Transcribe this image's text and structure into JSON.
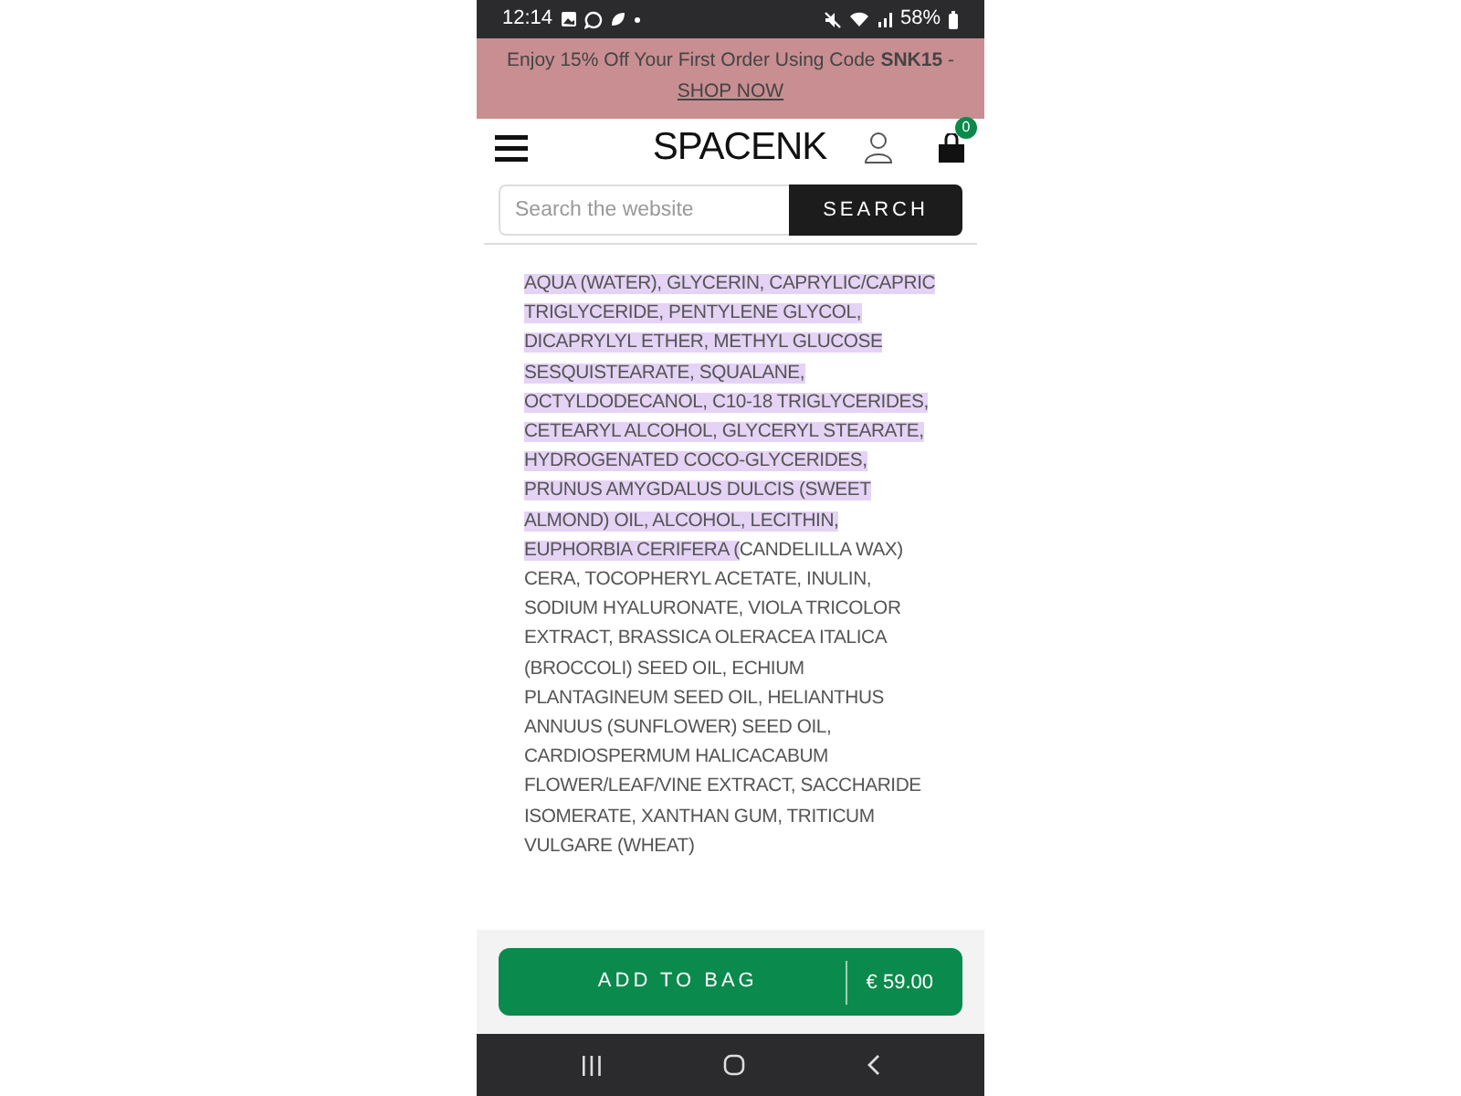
{
  "status_bar": {
    "time": "12:14",
    "battery": "58%"
  },
  "promo": {
    "text": "Enjoy 15% Off Your First Order Using Code **SNK15** -",
    "link": "SHOP NOW"
  },
  "header": {
    "logo": "SPACENK",
    "bag_count": "0"
  },
  "search": {
    "placeholder": "Search the website",
    "button": "SEARCH"
  },
  "ingredients": [
    {
      "text": "AQUA (WATER), GLYCERIN, CAPRYLIC/CAPRIC TRIGLYCERIDE, PENTYLENE GLYCOL, DICAPRYLYL ETHER, METHYL GLUCOSE SESQUISTEARATE, SQUALANE, OCTYLDODECANOL, C10-18 TRIGLYCERIDES, CETEARYL ALCOHOL, GLYCERYL STEARATE, HYDROGENATED COCO-GLYCERIDES, PRUNUS AMYGDALUS DULCIS (SWEET ALMOND) OIL, ALCOHOL, LECITHIN, EUPHORBIA CERIFERA (",
      "selected": true
    },
    {
      "text": "CANDELILLA WAX) CERA, TOCOPHERYL ACETATE, INULIN, SODIUM HYALURONATE, VIOLA TRICOLOR EXTRACT, BRASSICA OLERACEA ITALICA (BROCCOLI) SEED OIL, ECHIUM PLANTAGINEUM SEED OIL, HELIANTHUS ANNUUS (SUNFLOWER) SEED OIL, CARDIOSPERMUM HALICACABUM FLOWER/LEAF/VINE EXTRACT, SACCHARIDE ISOMERATE, XANTHAN GUM, TRITICUM VULGARE (WHEAT)",
      "selected": false
    }
  ],
  "add_to_bag": {
    "label": "ADD TO BAG",
    "price": "€ 59.00"
  }
}
